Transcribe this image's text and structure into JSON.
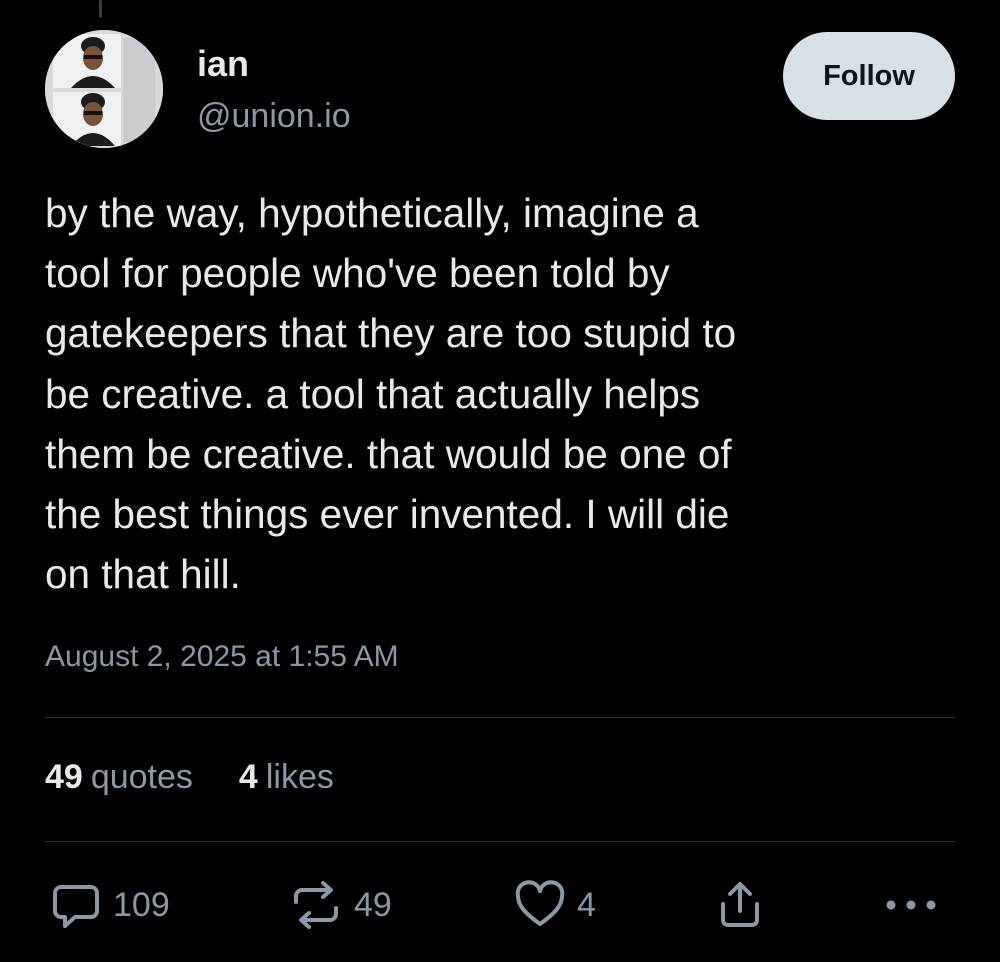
{
  "author": {
    "display_name": "ian",
    "handle": "@union.io"
  },
  "follow_button_label": "Follow",
  "post": {
    "text": "by the way, hypothetically, imagine a\ntool for people who've been told by\ngatekeepers that they are too stupid to\nbe creative. a tool that actually helps\nthem be creative. that would be one of\nthe best things ever invented. I will die\non that hill.",
    "timestamp": "August 2, 2025 at 1:55 AM"
  },
  "stats": {
    "quotes": {
      "count": "49",
      "label": "quotes"
    },
    "likes": {
      "count": "4",
      "label": "likes"
    }
  },
  "actions": {
    "replies": {
      "icon": "reply-icon",
      "count": "109"
    },
    "reposts": {
      "icon": "repost-icon",
      "count": "49"
    },
    "likes": {
      "icon": "heart-icon",
      "count": "4"
    },
    "share": {
      "icon": "share-icon"
    },
    "more": {
      "icon": "more-icon"
    }
  },
  "colors": {
    "background": "#000000",
    "text": "#e7e9ea",
    "muted": "#8b98a5",
    "divider": "#2f3336",
    "follow_button_bg": "#d8dfe5"
  }
}
